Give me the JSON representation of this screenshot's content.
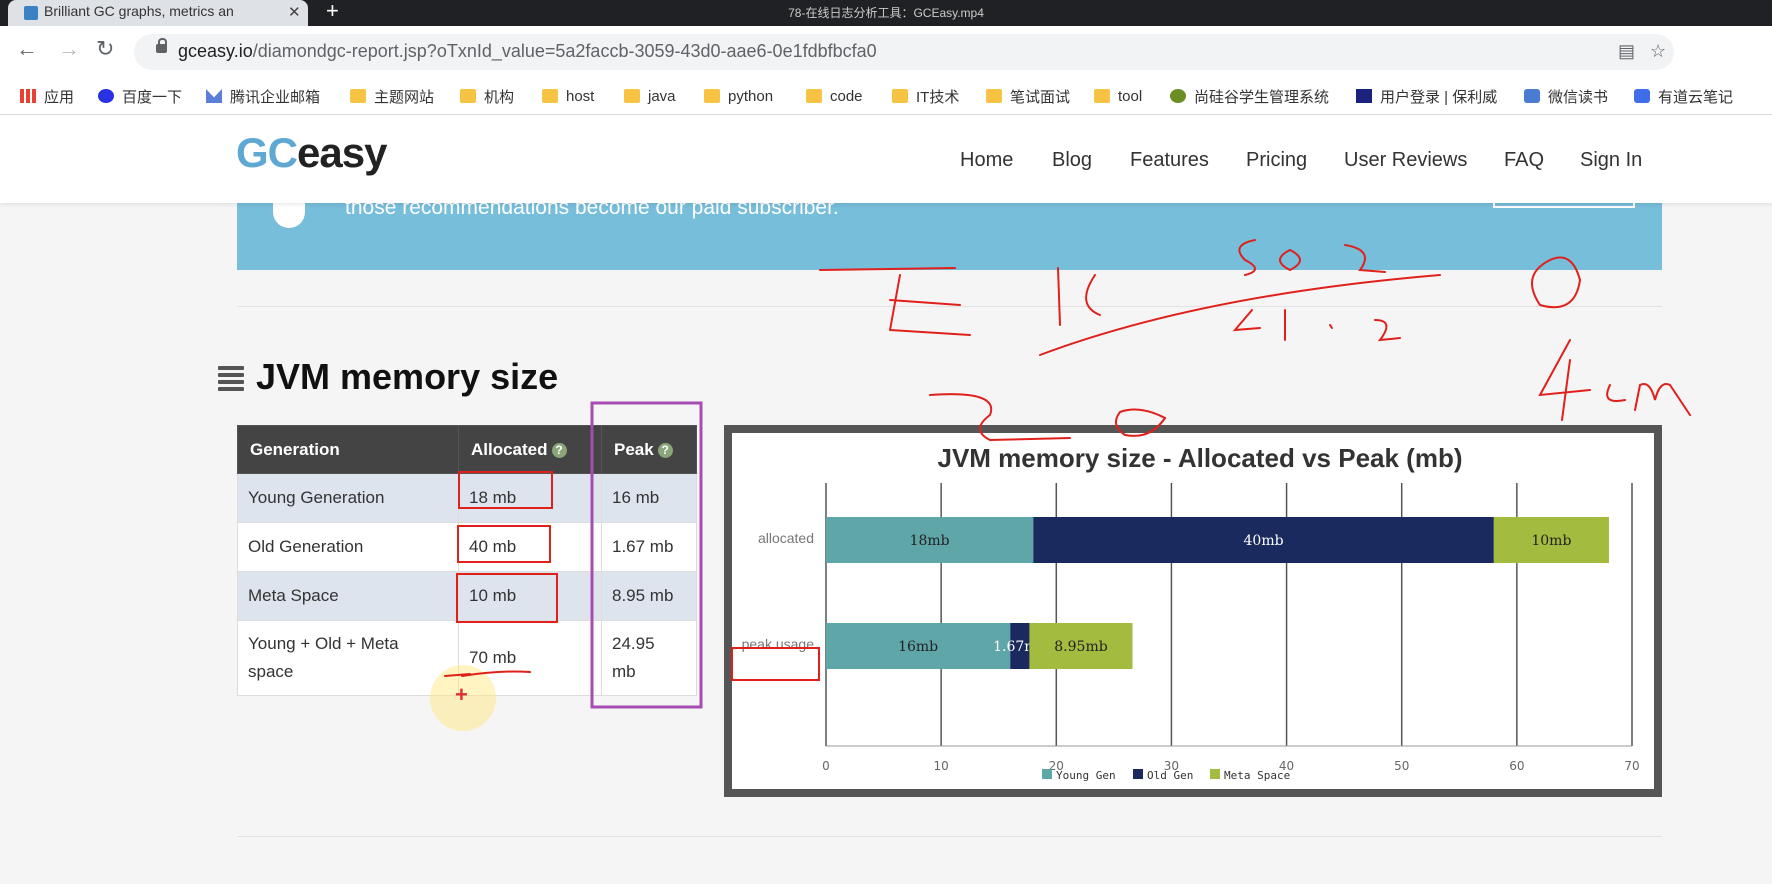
{
  "video_title": "78-在线日志分析工具：GCEasy.mp4",
  "tab": {
    "title": "Brilliant GC graphs, metrics an",
    "close": "✕",
    "new": "+"
  },
  "address": {
    "host": "gceasy.io",
    "path": "/diamondgc-report.jsp?oTxnId_value=5a2faccb-3059-43d0-aae6-0e1fdbfbcfa0"
  },
  "bookmarks": [
    "应用",
    "百度一下",
    "腾讯企业邮箱",
    "主题网站",
    "机构",
    "host",
    "java",
    "python",
    "code",
    "IT技术",
    "笔试面试",
    "tool",
    "尚硅谷学生管理系统",
    "用户登录 | 保利威",
    "微信读书",
    "有道云笔记"
  ],
  "site": {
    "logo_gc": "GC",
    "logo_easy": "easy",
    "nav": [
      "Home",
      "Blog",
      "Features",
      "Pricing",
      "User Reviews",
      "FAQ",
      "Sign In"
    ]
  },
  "banner": {
    "text": "those recommendations become our paid subscriber."
  },
  "section": {
    "title": "JVM memory size"
  },
  "table": {
    "headers": [
      "Generation",
      "Allocated",
      "Peak"
    ],
    "help": "?",
    "rows": [
      {
        "generation": "Young Generation",
        "allocated": "18 mb",
        "peak": "16 mb"
      },
      {
        "generation": "Old Generation",
        "allocated": "40 mb",
        "peak": "1.67 mb"
      },
      {
        "generation": "Meta Space",
        "allocated": "10 mb",
        "peak": "8.95 mb"
      },
      {
        "generation_line1": "Young + Old + Meta",
        "generation_line2": "space",
        "allocated": "70 mb",
        "peak_line1": "24.95",
        "peak_line2": "mb"
      }
    ]
  },
  "chart_data": {
    "type": "bar",
    "orientation": "horizontal",
    "stacked": true,
    "title": "JVM memory size - Allocated vs Peak (mb)",
    "categories": [
      "allocated",
      "peak usage"
    ],
    "series": [
      {
        "name": "Young Gen",
        "values": [
          18,
          16
        ],
        "labels": [
          "18mb",
          "16mb"
        ],
        "color": "#5fa6a8"
      },
      {
        "name": "Old Gen",
        "values": [
          40,
          1.67
        ],
        "labels": [
          "40mb",
          "1.67mb"
        ],
        "color": "#1a2a5e"
      },
      {
        "name": "Meta Space",
        "values": [
          10,
          8.95
        ],
        "labels": [
          "10mb",
          "8.95mb"
        ],
        "color": "#a3bb3f"
      }
    ],
    "xlim": [
      0,
      70
    ],
    "xticks": [
      0,
      10,
      20,
      30,
      40,
      50,
      60,
      70
    ],
    "grid": true,
    "legend": "bottom"
  },
  "annotations": {
    "strokes": "red handwritten marks"
  }
}
